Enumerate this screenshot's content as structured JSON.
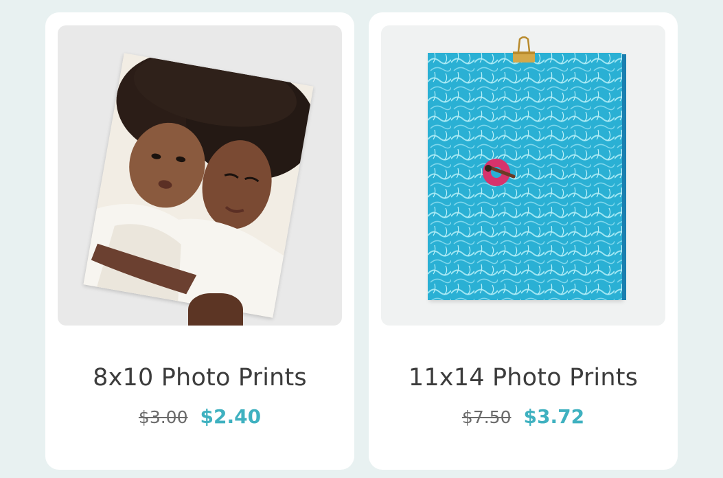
{
  "products": [
    {
      "title": "8x10 Photo Prints",
      "original_price": "$3.00",
      "sale_price": "$2.40"
    },
    {
      "title": "11x14 Photo Prints",
      "original_price": "$7.50",
      "sale_price": "$3.72"
    }
  ],
  "colors": {
    "page_background": "#e8f1f1",
    "card_background": "#ffffff",
    "sale_price": "#3fb1c0",
    "title_text": "#3c3c3c",
    "original_price": "#6b6b6b"
  }
}
